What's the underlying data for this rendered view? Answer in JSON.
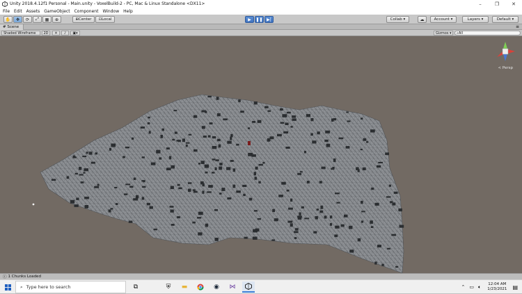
{
  "window": {
    "title": "Unity 2018.4.12f1 Personal - Main.unity - VoxelBuild-2 - PC, Mac & Linux Standalone <DX11>",
    "controls": [
      "–",
      "❐",
      "✕"
    ]
  },
  "menu": [
    "File",
    "Edit",
    "Assets",
    "GameObject",
    "Component",
    "Window",
    "Help"
  ],
  "toolbar": {
    "center_label": "Center",
    "local_label": "Local",
    "collab_label": "Collab ▾",
    "account_label": "Account",
    "layers_label": "Layers",
    "layout_label": "Default"
  },
  "scene": {
    "tab_label": "Scene",
    "shading_mode": "Shaded Wireframe",
    "mode_2d": "2D",
    "gizmos_label": "Gizmos",
    "search_placeholder": "All",
    "persp_label": "< Persp"
  },
  "status": {
    "message": "1 Chunks Loaded"
  },
  "taskbar": {
    "search_placeholder": "Type here to search",
    "time": "12:04 AM",
    "date": "1/23/2021"
  },
  "colors": {
    "viewport_bg": "#726a63",
    "terrain": "#8a8d90",
    "wire": "#5d6064",
    "voxel_dark": "#2b2e31",
    "accent": "#3c7fd8"
  }
}
